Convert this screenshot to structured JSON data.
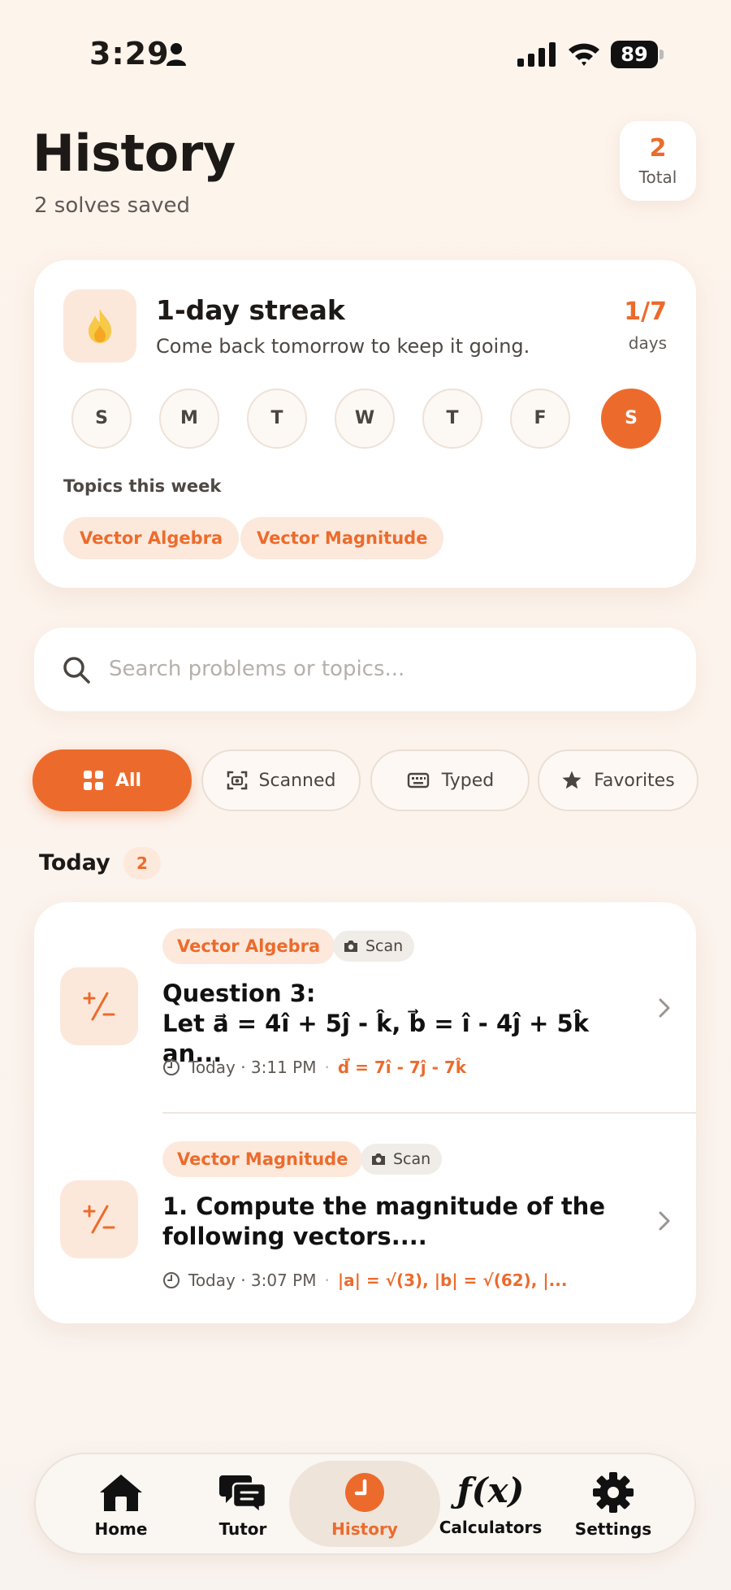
{
  "status_bar": {
    "time": "3:29",
    "battery": "89"
  },
  "header": {
    "title": "History",
    "subtitle": "2 solves saved",
    "total_value": "2",
    "total_label": "Total"
  },
  "streak": {
    "title": "1-day streak",
    "subtitle": "Come back tomorrow to keep it going.",
    "count": "1/7",
    "unit": "days",
    "days": [
      "S",
      "M",
      "T",
      "W",
      "T",
      "F",
      "S"
    ],
    "active_day_index": 6,
    "topics_label": "Topics this week",
    "topics": [
      "Vector Algebra",
      "Vector Magnitude"
    ]
  },
  "search": {
    "placeholder": "Search problems or topics...",
    "value": ""
  },
  "filters": [
    {
      "label": "All",
      "icon": "grid-icon",
      "active": true
    },
    {
      "label": "Scanned",
      "icon": "scan-icon",
      "active": false
    },
    {
      "label": "Typed",
      "icon": "keyboard-icon",
      "active": false
    },
    {
      "label": "Favorites",
      "icon": "star-icon",
      "active": false
    }
  ],
  "section": {
    "title": "Today",
    "count": "2"
  },
  "history": [
    {
      "topic": "Vector Algebra",
      "source": "Scan",
      "question": "Question 3:\nLet a⃗ = 4î + 5ĵ - k̂, b⃗ = î - 4ĵ + 5k̂ an...",
      "time": "Today · 3:11 PM",
      "answer": "d⃗ = 7î - 7ĵ - 7k̂"
    },
    {
      "topic": "Vector Magnitude",
      "source": "Scan",
      "question": "1. Compute the magnitude of the following vectors....",
      "time": "Today · 3:07 PM",
      "answer": "|a| = √(3), |b| = √(62), |..."
    }
  ],
  "nav": [
    {
      "label": "Home",
      "icon": "home-icon",
      "active": false
    },
    {
      "label": "Tutor",
      "icon": "chat-icon",
      "active": false
    },
    {
      "label": "History",
      "icon": "clock-icon",
      "active": true
    },
    {
      "label": "Calculators",
      "icon": "function-icon",
      "active": false
    },
    {
      "label": "Settings",
      "icon": "gear-icon",
      "active": false
    }
  ],
  "colors": {
    "accent": "#ec6b2c",
    "accent_soft": "#fce9dc",
    "background": "#fdf4ec",
    "text": "#1c1917"
  }
}
